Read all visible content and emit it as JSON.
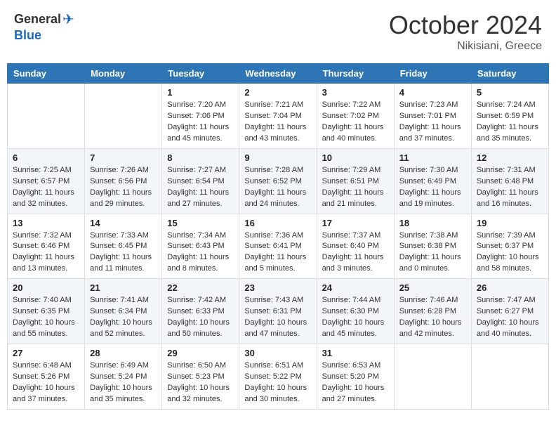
{
  "header": {
    "logo_general": "General",
    "logo_blue": "Blue",
    "month_title": "October 2024",
    "location": "Nikisiani, Greece"
  },
  "weekdays": [
    "Sunday",
    "Monday",
    "Tuesday",
    "Wednesday",
    "Thursday",
    "Friday",
    "Saturday"
  ],
  "weeks": [
    [
      {
        "day": "",
        "info": ""
      },
      {
        "day": "",
        "info": ""
      },
      {
        "day": "1",
        "info": "Sunrise: 7:20 AM\nSunset: 7:06 PM\nDaylight: 11 hours and 45 minutes."
      },
      {
        "day": "2",
        "info": "Sunrise: 7:21 AM\nSunset: 7:04 PM\nDaylight: 11 hours and 43 minutes."
      },
      {
        "day": "3",
        "info": "Sunrise: 7:22 AM\nSunset: 7:02 PM\nDaylight: 11 hours and 40 minutes."
      },
      {
        "day": "4",
        "info": "Sunrise: 7:23 AM\nSunset: 7:01 PM\nDaylight: 11 hours and 37 minutes."
      },
      {
        "day": "5",
        "info": "Sunrise: 7:24 AM\nSunset: 6:59 PM\nDaylight: 11 hours and 35 minutes."
      }
    ],
    [
      {
        "day": "6",
        "info": "Sunrise: 7:25 AM\nSunset: 6:57 PM\nDaylight: 11 hours and 32 minutes."
      },
      {
        "day": "7",
        "info": "Sunrise: 7:26 AM\nSunset: 6:56 PM\nDaylight: 11 hours and 29 minutes."
      },
      {
        "day": "8",
        "info": "Sunrise: 7:27 AM\nSunset: 6:54 PM\nDaylight: 11 hours and 27 minutes."
      },
      {
        "day": "9",
        "info": "Sunrise: 7:28 AM\nSunset: 6:52 PM\nDaylight: 11 hours and 24 minutes."
      },
      {
        "day": "10",
        "info": "Sunrise: 7:29 AM\nSunset: 6:51 PM\nDaylight: 11 hours and 21 minutes."
      },
      {
        "day": "11",
        "info": "Sunrise: 7:30 AM\nSunset: 6:49 PM\nDaylight: 11 hours and 19 minutes."
      },
      {
        "day": "12",
        "info": "Sunrise: 7:31 AM\nSunset: 6:48 PM\nDaylight: 11 hours and 16 minutes."
      }
    ],
    [
      {
        "day": "13",
        "info": "Sunrise: 7:32 AM\nSunset: 6:46 PM\nDaylight: 11 hours and 13 minutes."
      },
      {
        "day": "14",
        "info": "Sunrise: 7:33 AM\nSunset: 6:45 PM\nDaylight: 11 hours and 11 minutes."
      },
      {
        "day": "15",
        "info": "Sunrise: 7:34 AM\nSunset: 6:43 PM\nDaylight: 11 hours and 8 minutes."
      },
      {
        "day": "16",
        "info": "Sunrise: 7:36 AM\nSunset: 6:41 PM\nDaylight: 11 hours and 5 minutes."
      },
      {
        "day": "17",
        "info": "Sunrise: 7:37 AM\nSunset: 6:40 PM\nDaylight: 11 hours and 3 minutes."
      },
      {
        "day": "18",
        "info": "Sunrise: 7:38 AM\nSunset: 6:38 PM\nDaylight: 11 hours and 0 minutes."
      },
      {
        "day": "19",
        "info": "Sunrise: 7:39 AM\nSunset: 6:37 PM\nDaylight: 10 hours and 58 minutes."
      }
    ],
    [
      {
        "day": "20",
        "info": "Sunrise: 7:40 AM\nSunset: 6:35 PM\nDaylight: 10 hours and 55 minutes."
      },
      {
        "day": "21",
        "info": "Sunrise: 7:41 AM\nSunset: 6:34 PM\nDaylight: 10 hours and 52 minutes."
      },
      {
        "day": "22",
        "info": "Sunrise: 7:42 AM\nSunset: 6:33 PM\nDaylight: 10 hours and 50 minutes."
      },
      {
        "day": "23",
        "info": "Sunrise: 7:43 AM\nSunset: 6:31 PM\nDaylight: 10 hours and 47 minutes."
      },
      {
        "day": "24",
        "info": "Sunrise: 7:44 AM\nSunset: 6:30 PM\nDaylight: 10 hours and 45 minutes."
      },
      {
        "day": "25",
        "info": "Sunrise: 7:46 AM\nSunset: 6:28 PM\nDaylight: 10 hours and 42 minutes."
      },
      {
        "day": "26",
        "info": "Sunrise: 7:47 AM\nSunset: 6:27 PM\nDaylight: 10 hours and 40 minutes."
      }
    ],
    [
      {
        "day": "27",
        "info": "Sunrise: 6:48 AM\nSunset: 5:26 PM\nDaylight: 10 hours and 37 minutes."
      },
      {
        "day": "28",
        "info": "Sunrise: 6:49 AM\nSunset: 5:24 PM\nDaylight: 10 hours and 35 minutes."
      },
      {
        "day": "29",
        "info": "Sunrise: 6:50 AM\nSunset: 5:23 PM\nDaylight: 10 hours and 32 minutes."
      },
      {
        "day": "30",
        "info": "Sunrise: 6:51 AM\nSunset: 5:22 PM\nDaylight: 10 hours and 30 minutes."
      },
      {
        "day": "31",
        "info": "Sunrise: 6:53 AM\nSunset: 5:20 PM\nDaylight: 10 hours and 27 minutes."
      },
      {
        "day": "",
        "info": ""
      },
      {
        "day": "",
        "info": ""
      }
    ]
  ]
}
